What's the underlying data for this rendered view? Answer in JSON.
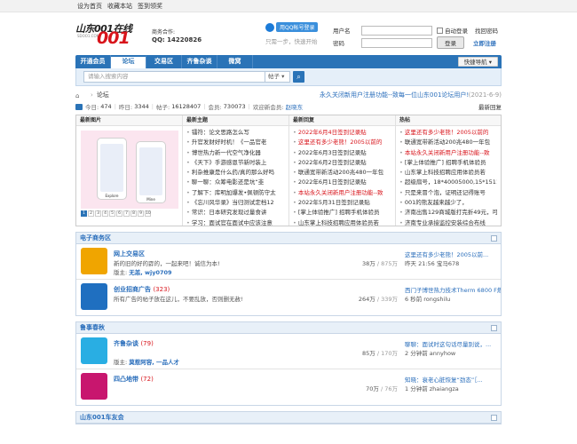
{
  "topbar": {
    "links": [
      "设为首页",
      "收藏本站",
      "签到领奖"
    ]
  },
  "header": {
    "logo_text": "山东001在线",
    "logo_sub": "SDOO1.COM",
    "logo_big": "001",
    "coop_label": "商务合作:",
    "coop_qq": "QQ: 14220826",
    "qq_login_label": "用QQ帐号登录",
    "qq_tip": "只需一步，快速开始"
  },
  "login": {
    "username_label": "用户名",
    "password_label": "密码",
    "auto_login": "自动登录",
    "find_password": "找回密码",
    "login_button": "登录",
    "register": "立即注册"
  },
  "nav": {
    "items": [
      "开通会员",
      "论坛",
      "交易区",
      "齐鲁杂谈",
      "微窝"
    ],
    "quick": "快捷导航"
  },
  "search": {
    "placeholder": "请输入搜索内容",
    "type": "帖子"
  },
  "breadcrumb": {
    "home": "论坛",
    "notice": "永久关闭新用户注册功能--致每一位山东001论坛用户!",
    "date": "(2021-6-9)"
  },
  "stats": {
    "today_label": "今日:",
    "today": "474",
    "yesterday_label": "昨日:",
    "yesterday": "3344",
    "posts_label": "帖子:",
    "posts": "16128407",
    "members_label": "会员:",
    "members": "730073",
    "welcome_label": "欢迎新会员:",
    "new_member": "赵晓东",
    "newest": "最新回复"
  },
  "feature": {
    "headers": [
      "最新图片",
      "最新主题",
      "最新回复",
      "热帖"
    ],
    "pager": [
      "1",
      "2",
      "3",
      "4",
      "5",
      "6",
      "7",
      "8",
      "9",
      "10"
    ],
    "phone_caps": [
      "Explore",
      "Mine"
    ],
    "topics": [
      "镭符：论文思路怎么写",
      "升官发财好时机！《一品官老",
      "博世热力新一代空气净化器",
      "《天下》手游感恩节新时装上",
      "利杂推康是什么药/真的那么好吗",
      "聊一聊：众筹电影还是坑“韭",
      "了解下：库明加爆发•佩顿防守太",
      "《忘川风华录》当归测试定档12",
      "常识：日本研究发现过量食讲",
      "学习：面试官在面试中应该注意"
    ],
    "replies": [
      "2022年6月4日签到记录贴",
      "这里还有多少老熊！2005以前的",
      "2022年6月3日签到记录贴",
      "2022年6月2日签到记录贴",
      "联通宽带新活动200兆480一年包",
      "2022年6月1日签到记录贴",
      "本站永久关闭新用户注册功能--致",
      "2022年5月31日签到记录贴",
      "[掌上体验推广] 招聘手机体验员",
      "山东掌上科技招聘应用体验员若"
    ],
    "hot": [
      "这里还有多少老熊！2005以前的",
      "联通宽带新活动200兆480一年包",
      "本站永久关闭新用户注册功能--致",
      "[掌上体验推广] 招聘手机体验员",
      "山东掌上科技招聘应用体验员若",
      "超级扇号，18*40005000,15*1511",
      "只是来冒个泡，证明还记得账号",
      "001的熊友越来越少了，",
      "济南出售129商城版打完折49元，可",
      "济南专业承接监控安装综合布线"
    ]
  },
  "sections": [
    {
      "title": "电子商务区",
      "forums": [
        {
          "name": "网上交易区",
          "count": "",
          "desc": "新的旧的好的孬的，一起来吧！诚信为本!",
          "mod_label": "版主:",
          "mods": "无恙, wjy0709",
          "topics": "38万",
          "posts": "875万",
          "last_title": "这里还有多少老熊！2005以前...",
          "last_meta": "昨天 21:56 宝马678",
          "color": "#f0a500"
        },
        {
          "name": "创业招商广告",
          "count": "(323)",
          "desc": "所有广告的帖子放在这儿，不要乱放，否则删无赦!",
          "mod_label": "",
          "mods": "",
          "topics": "264万",
          "posts": "339万",
          "last_title": "西门子博世热力技术Therm 6800 F燃...",
          "last_meta": "6 秒前 rongshilu",
          "color": "#1f6fc0"
        }
      ]
    },
    {
      "title": "鲁事春秋",
      "forums": [
        {
          "name": "齐鲁杂谈",
          "count": "(79)",
          "desc": "",
          "mod_label": "版主:",
          "mods": "莫惹阿容, 一品人才",
          "topics": "85万",
          "posts": "170万",
          "last_title": "聊聊：面试时这句话尽量别说，...",
          "last_meta": "2 分钟前 annyhow",
          "color": "#29aee3"
        },
        {
          "name": "四凸地带",
          "count": "(72)",
          "desc": "",
          "mod_label": "",
          "mods": "",
          "topics": "70万",
          "posts": "76万",
          "last_title": "知晓：衰老心脏恢复“劲态”［...",
          "last_meta": "1 分钟前 zhaiangza",
          "color": "#c8166e"
        }
      ]
    },
    {
      "title": "山东001车友会",
      "forums": []
    }
  ],
  "colors": {
    "nav": "#2a73b7",
    "accent_red": "#d8141b",
    "link": "#2a6ebb"
  }
}
